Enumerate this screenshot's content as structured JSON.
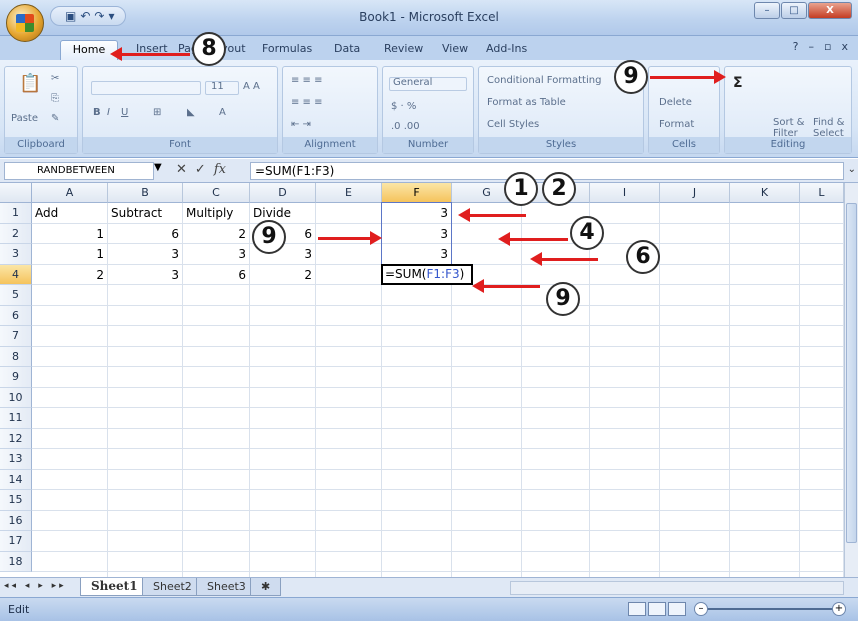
{
  "window": {
    "title": "Book1 - Microsoft Excel",
    "qat_icons": [
      "save-icon",
      "undo-icon",
      "redo-icon"
    ],
    "btn_min": "–",
    "btn_max": "□",
    "btn_close": "X"
  },
  "ribbon": {
    "tabs": [
      "Home",
      "Insert",
      "Page Layout",
      "Formulas",
      "Data",
      "Review",
      "View",
      "Add-Ins"
    ],
    "help": "?",
    "groups": {
      "clipboard": {
        "label": "Clipboard",
        "paste": "Paste"
      },
      "font": {
        "label": "Font",
        "size": "11"
      },
      "alignment": {
        "label": "Alignment"
      },
      "number": {
        "label": "Number",
        "format": "General"
      },
      "styles": {
        "label": "Styles",
        "conditional": "Conditional Formatting",
        "table": "Format as Table",
        "cell_styles": "Cell Styles"
      },
      "cells": {
        "label": "Cells",
        "delete": "Delete",
        "format": "Format"
      },
      "editing": {
        "label": "Editing",
        "sigma": "Σ",
        "sort": "Sort & Filter",
        "find": "Find & Select"
      }
    }
  },
  "formula_bar": {
    "name_box": "RANDBETWEEN",
    "fx": "fx",
    "formula": "=SUM(F1:F3)"
  },
  "grid": {
    "columns": [
      "A",
      "B",
      "C",
      "D",
      "E",
      "F",
      "G",
      "H",
      "I",
      "J",
      "K",
      "L"
    ],
    "rows": [
      "1",
      "2",
      "3",
      "4",
      "5",
      "6",
      "7",
      "8",
      "9",
      "10",
      "11",
      "12",
      "13",
      "14",
      "15",
      "16",
      "17",
      "18"
    ],
    "cells": {
      "A1": "Add",
      "B1": "Subtract",
      "C1": "Multiply",
      "D1": "Divide",
      "A2": "1",
      "B2": "6",
      "C2": "2",
      "D2": "6",
      "A3": "1",
      "B3": "3",
      "C3": "3",
      "D3": "3",
      "A4": "2",
      "B4": "3",
      "C4": "6",
      "D4": "2",
      "F1": "3",
      "F2": "3",
      "F3": "3"
    },
    "active_cell_text": "=SUM(",
    "active_cell_ref": "F1:F3",
    "active_cell_close": ")"
  },
  "sheets": [
    "Sheet1",
    "Sheet2",
    "Sheet3"
  ],
  "status": {
    "mode": "Edit"
  },
  "annotations": {
    "n1": "1",
    "n2": "2",
    "n4": "4",
    "n6": "6",
    "n8": "8",
    "n9": "9"
  },
  "colors": {
    "arrow": "#e01e1e",
    "selection": "#5b76c7",
    "ref_text": "#3355cc"
  }
}
